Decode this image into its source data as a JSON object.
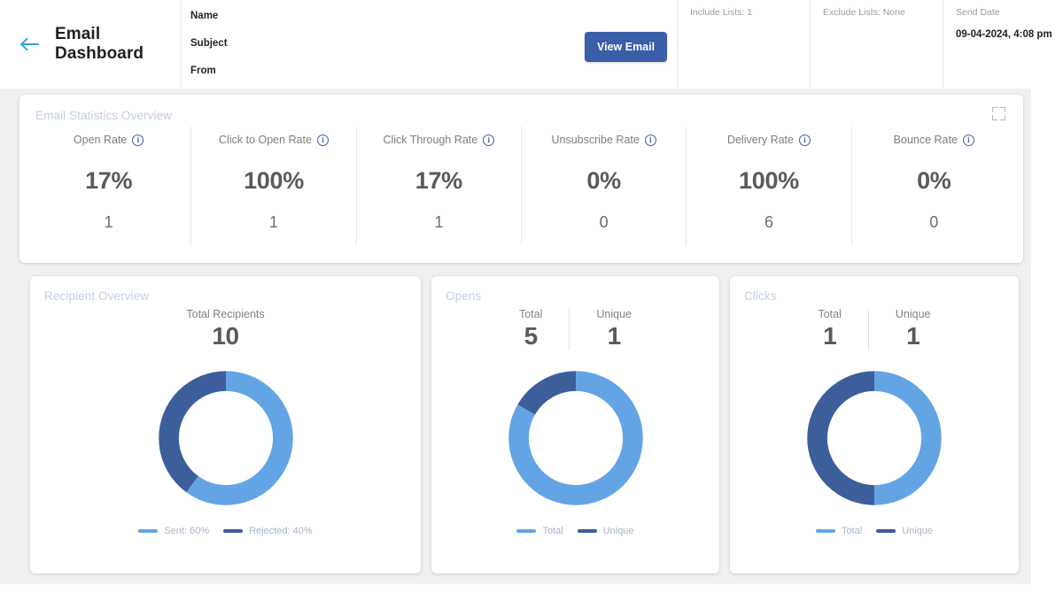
{
  "header": {
    "back_icon": "arrow-left-icon",
    "title": "Email Dashboard",
    "meta_fields": [
      "Name",
      "Subject",
      "From"
    ],
    "view_email_label": "View Email",
    "include_lists": "Include Lists: 1",
    "exclude_lists": "Exclude Lists: None",
    "send_date_label": "Send Date",
    "send_date_value": "09-04-2024, 4:08 pm"
  },
  "stats": {
    "title": "Email Statistics Overview",
    "expand_icon": "fullscreen-expand-icon",
    "items": [
      {
        "label": "Open Rate",
        "value": "17%",
        "count": "1"
      },
      {
        "label": "Click to Open Rate",
        "value": "100%",
        "count": "1"
      },
      {
        "label": "Click Through Rate",
        "value": "17%",
        "count": "1"
      },
      {
        "label": "Unsubscribe Rate",
        "value": "0%",
        "count": "0"
      },
      {
        "label": "Delivery Rate",
        "value": "100%",
        "count": "6"
      },
      {
        "label": "Bounce Rate",
        "value": "0%",
        "count": "0"
      }
    ]
  },
  "recipients": {
    "title": "Recipient Overview",
    "kpi_label": "Total Recipients",
    "kpi_value": "10",
    "legend": [
      {
        "label": "Sent: 60%",
        "color": "#63a4e4"
      },
      {
        "label": "Rejected: 40%",
        "color": "#3c5e9b"
      }
    ]
  },
  "opens": {
    "title": "Opens",
    "total_label": "Total",
    "total_value": "5",
    "unique_label": "Unique",
    "unique_value": "1",
    "legend": [
      {
        "label": "Total",
        "color": "#63a4e4"
      },
      {
        "label": "Unique",
        "color": "#3c5e9b"
      }
    ]
  },
  "clicks": {
    "title": "Clicks",
    "total_label": "Total",
    "total_value": "1",
    "unique_label": "Unique",
    "unique_value": "1",
    "legend": [
      {
        "label": "Total",
        "color": "#63a4e4"
      },
      {
        "label": "Unique",
        "color": "#3c5e9b"
      }
    ]
  },
  "colors": {
    "accent_blue": "#3b5ea8",
    "light_blue": "#63a4e4",
    "dark_blue": "#3c5e9b",
    "back_arrow": "#29a3e0",
    "card_title": "#c3cfe0",
    "page_bg": "#f0f0f0"
  },
  "chart_data": [
    {
      "type": "pie",
      "title": "Recipient Overview",
      "variant": "donut",
      "categories": [
        "Sent",
        "Rejected"
      ],
      "values": [
        60,
        40
      ],
      "value_unit": "percent",
      "total": 10,
      "total_label": "Total Recipients",
      "colors": [
        "#63a4e4",
        "#3c5e9b"
      ],
      "start_angle": 0,
      "direction": "clockwise",
      "legend": [
        "Sent: 60%",
        "Rejected: 40%"
      ],
      "legend_position": "bottom"
    },
    {
      "type": "pie",
      "title": "Opens",
      "variant": "donut",
      "categories": [
        "Total",
        "Unique"
      ],
      "values": [
        5,
        1
      ],
      "percentages": [
        83.3,
        16.7
      ],
      "colors": [
        "#63a4e4",
        "#3c5e9b"
      ],
      "start_angle": 0,
      "direction": "clockwise",
      "legend": [
        "Total",
        "Unique"
      ],
      "legend_position": "bottom"
    },
    {
      "type": "pie",
      "title": "Clicks",
      "variant": "donut",
      "categories": [
        "Total",
        "Unique"
      ],
      "values": [
        1,
        1
      ],
      "percentages": [
        50,
        50
      ],
      "colors": [
        "#63a4e4",
        "#3c5e9b"
      ],
      "start_angle": 0,
      "direction": "clockwise",
      "legend": [
        "Total",
        "Unique"
      ],
      "legend_position": "bottom"
    }
  ]
}
